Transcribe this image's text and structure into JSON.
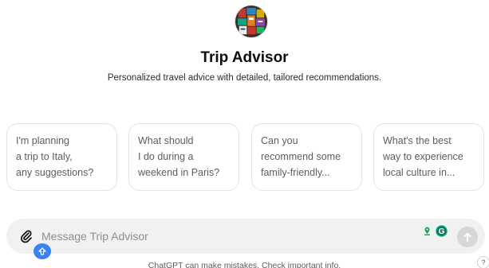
{
  "gpt": {
    "name": "Trip Advisor",
    "description": "Personalized travel advice with detailed, tailored recommendations."
  },
  "starters": [
    {
      "text": "I'm planning\na trip to Italy,\nany suggestions?"
    },
    {
      "text": "What should\nI do during a\nweekend in Paris?"
    },
    {
      "text": "Can you\nrecommend some\nfamily-friendly..."
    },
    {
      "text": "What's the best\nway to experience\nlocal culture in..."
    }
  ],
  "composer": {
    "placeholder": "Message Trip Advisor"
  },
  "footer": {
    "disclaimer": "ChatGPT can make mistakes. Check important info.",
    "help": "?"
  },
  "icons": {
    "avatar": "luggage-collage-avatar",
    "attach": "paperclip-icon",
    "extension_1": "location-pin-extension-icon",
    "extension_2": "grammarly-icon",
    "send": "arrow-up-icon",
    "badge": "upload-badge-icon"
  },
  "colors": {
    "card_border": "#e3e3e3",
    "composer_bg": "#f1f1f1",
    "send_bg": "#d7d7d7",
    "grammarly": "#15c39a",
    "badge": "#3b82f6"
  }
}
